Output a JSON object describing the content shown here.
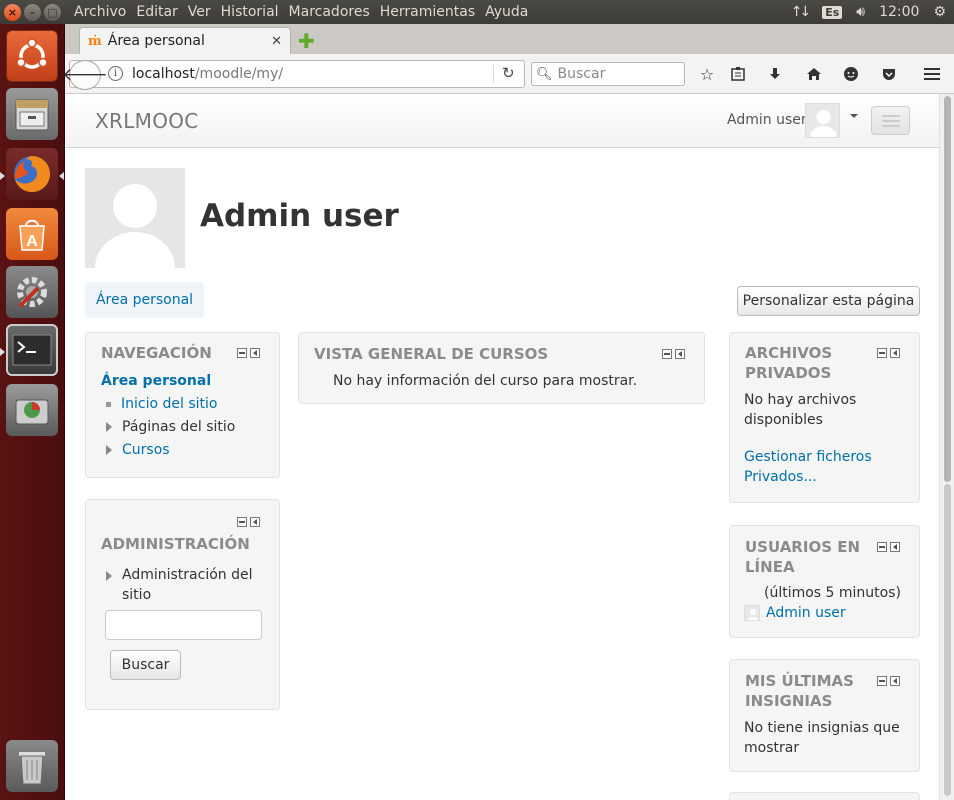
{
  "os_panel": {
    "menu": [
      "Archivo",
      "Editar",
      "Ver",
      "Historial",
      "Marcadores",
      "Herramientas",
      "Ayuda"
    ],
    "lang": "Es",
    "clock": "12:00"
  },
  "browser": {
    "tab_title": "Área personal",
    "url_host": "localhost",
    "url_path": "/moodle/my/",
    "search_placeholder": "Buscar"
  },
  "site": {
    "brand": "XRLMOOC",
    "user_name": "Admin user",
    "page_title": "Admin user",
    "breadcrumb": "Área personal",
    "customize_button": "Personalizar esta página"
  },
  "blocks": {
    "navigation": {
      "title": "NAVEGACIÓN",
      "current": "Área personal",
      "items": [
        "Inicio del sitio",
        "Páginas del sitio",
        "Cursos"
      ]
    },
    "administration": {
      "title": "ADMINISTRACIÓN",
      "item_line1": "Administración del",
      "item_line2": "sitio",
      "search_button": "Buscar"
    },
    "course_overview": {
      "title": "VISTA GENERAL DE CURSOS",
      "message": "No hay información del curso para mostrar."
    },
    "private_files": {
      "title_line1": "ARCHIVOS",
      "title_line2": "PRIVADOS",
      "message_line1": "No hay archivos",
      "message_line2": "disponibles",
      "link_line1": "Gestionar ficheros",
      "link_line2": "Privados..."
    },
    "online_users": {
      "title_line1": "USUARIOS EN",
      "title_line2": "LÍNEA",
      "subtitle": "(últimos 5 minutos)",
      "user": "Admin user"
    },
    "badges": {
      "title_line1": "MIS ÚLTIMAS",
      "title_line2": "INSIGNIAS",
      "message_line1": "No tiene insignias que",
      "message_line2": "mostrar"
    }
  }
}
